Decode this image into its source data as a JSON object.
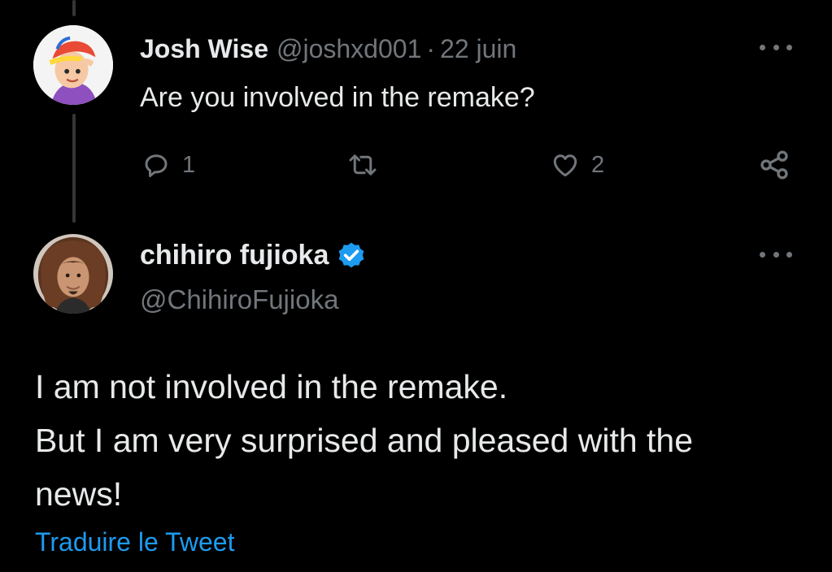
{
  "reply": {
    "author_name": "Josh Wise",
    "handle": "@joshxd001",
    "separator": "·",
    "date": "22 juin",
    "text": "Are you involved in the remake?",
    "avatar_icon": "cartoon-avatar",
    "actions": {
      "reply_icon": "comment-icon",
      "reply_count": "1",
      "retweet_icon": "retweet-icon",
      "like_icon": "heart-icon",
      "like_count": "2",
      "share_icon": "share-icon"
    }
  },
  "tweet": {
    "author_name": "chihiro fujioka",
    "verified": true,
    "handle": "@ChihiroFujioka",
    "avatar_icon": "photo-avatar",
    "text_lines": [
      "I am not involved in the remake.",
      "But I am very surprised and pleased with the",
      "news!"
    ],
    "translate_label": "Traduire le Tweet"
  },
  "colors": {
    "background": "#000000",
    "text": "#e7e9ea",
    "muted": "#71767b",
    "link": "#1d9bf0",
    "verified": "#1d9bf0",
    "thread_line": "#333639"
  }
}
